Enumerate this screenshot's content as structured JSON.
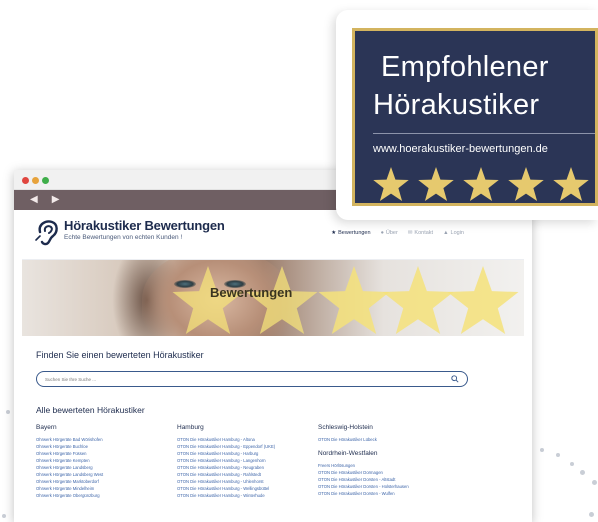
{
  "colors": {
    "navy": "#1d2b4d",
    "badge_bg": "#2b3556",
    "gold": "#d3b45f",
    "link": "#3c64a8",
    "toolbar": "#6f5f63"
  },
  "badge": {
    "line1": "Empfohlener",
    "line2": "Hörakustiker",
    "url": "www.hoerakustiker-bewertungen.de",
    "star_count": 5
  },
  "browser": {
    "back_icon": "chevron-left-icon",
    "forward_icon": "chevron-right-icon"
  },
  "site": {
    "title": "Hörakustiker Bewertungen",
    "subtitle": "Echte Bewertungen von echten Kunden !",
    "nav": [
      {
        "label": "Bewertungen",
        "icon": "star-icon"
      },
      {
        "label": "Über",
        "icon": "info-icon"
      },
      {
        "label": "Kontakt",
        "icon": "mail-icon"
      },
      {
        "label": "Login",
        "icon": "user-icon"
      }
    ],
    "hero_text": "Bewertungen",
    "search_title": "Finden Sie einen bewerteten Hörakustiker",
    "search_placeholder": "Suchen Sie Ihre Suche ...",
    "list_title": "Alle bewerteten Hörakustiker"
  },
  "regions": [
    {
      "name": "Bayern",
      "links": [
        "Ohrwerk Hörgeräte Bad Wörishofen",
        "Ohrwerk Hörgeräte Buchloe",
        "Ohrwerk Hörgeräte Füssen",
        "Ohrwerk Hörgeräte Kempten",
        "Ohrwerk Hörgeräte Landsberg",
        "Ohrwerk Hörgeräte Landsberg West",
        "Ohrwerk Hörgeräte Marktoberdorf",
        "Ohrwerk Hörgeräte Mindelheim",
        "Ohrwerk Hörgeräte Obergünzburg"
      ]
    },
    {
      "name": "Hamburg",
      "links": [
        "OTON Die Hörakustiker Hamburg - Altona",
        "OTON Die Hörakustiker Hamburg - Eppendorf (UKE)",
        "OTON Die Hörakustiker Hamburg - Harburg",
        "OTON Die Hörakustiker Hamburg - Langenhorn",
        "OTON Die Hörakustiker Hamburg - Neugraben",
        "OTON Die Hörakustiker Hamburg - Rahlstedt",
        "OTON Die Hörakustiker Hamburg - Uhlenhorst",
        "OTON Die Hörakustiker Hamburg - Wellingsbüttel",
        "OTON Die Hörakustiker Hamburg - Winterhude"
      ]
    },
    {
      "name": "Schleswig-Holstein",
      "links": [
        "OTON Die Hörakustiker Lübeck"
      ]
    },
    {
      "name": "Nordrhein-Westfalen",
      "links": [
        "Freers Hörlösungen",
        "OTON Die Hörakustiker Dormagen",
        "OTON Die Hörakustiker Dorsten - Altstadt",
        "OTON Die Hörakustiker Dorsten - Holsterhausen",
        "OTON Die Hörakustiker Dorsten - Wulfen"
      ]
    }
  ]
}
